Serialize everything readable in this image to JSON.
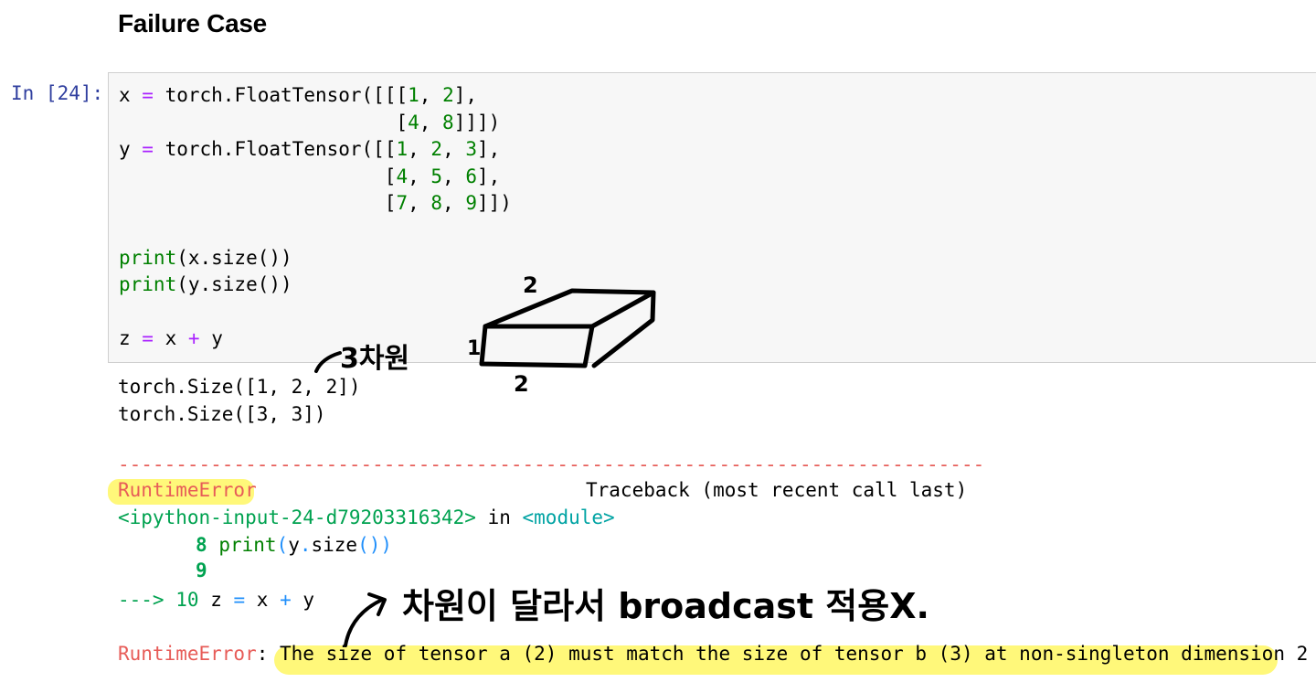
{
  "heading": "Failure Case",
  "cell": {
    "prompt": "In [24]:",
    "code_lines": [
      "x = torch.FloatTensor([[[1, 2],",
      "                        [4, 8]]])",
      "y = torch.FloatTensor([[1, 2, 3],",
      "                       [4, 5, 6],",
      "                       [7, 8, 9]])",
      "",
      "print(x.size())",
      "print(y.size())",
      "",
      "z = x + y"
    ]
  },
  "output": {
    "lines": [
      "torch.Size([1, 2, 2])",
      "torch.Size([3, 3])"
    ]
  },
  "traceback": {
    "separator": "---------------------------------------------------------------------------",
    "error_type": "RuntimeError",
    "header_right": "Traceback (most recent call last)",
    "input_ref": "<ipython-input-24-d79203316342>",
    "in_word": " in ",
    "module_ref": "<module>",
    "line8_no": "8",
    "line8_code": "print(y.size())",
    "line9_no": "9",
    "arrow": "--->",
    "line10_no": "10",
    "line10_code": "z = x + y",
    "final_type": "RuntimeError",
    "final_colon": ": ",
    "final_message": "The size of tensor a (2) must match the size of tensor b (3) at non-singleton dimension 2"
  },
  "annotations": {
    "dim_note": "3차원",
    "dim_label_top": "2",
    "dim_label_left": "1",
    "dim_label_bottom": "2",
    "broadcast_note": "차원이 달라서 broadcast 적용X."
  },
  "colors": {
    "prompt": "#303f9f",
    "keyword_op": "#aa22ff",
    "number": "#008000",
    "error_red": "#e75c58",
    "highlight": "#fff87a"
  }
}
